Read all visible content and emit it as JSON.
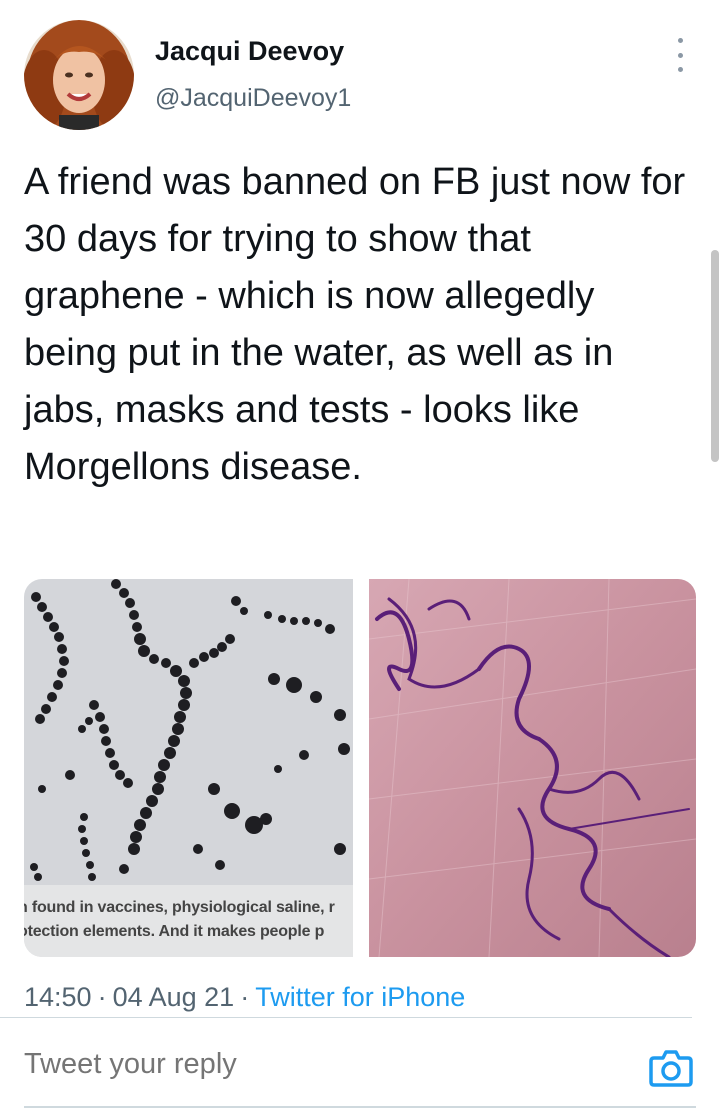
{
  "tweet": {
    "author": {
      "display_name": "Jacqui Deevoy",
      "handle": "@JacquiDeevoy1"
    },
    "text": "A friend was banned on FB just now for 30 days for trying to show that graphene - which is now allegedly being put in the water, as well as in jabs, masks and tests - looks like Morgellons disease.",
    "media": [
      {
        "caption_lines": [
          "n found in vaccines, physiological saline, r",
          "otection elements. And it makes people p"
        ]
      },
      {}
    ],
    "time": "14:50",
    "date": "04 Aug 21",
    "separator": "·",
    "source": "Twitter for iPhone"
  },
  "reply": {
    "placeholder": "Tweet your reply"
  },
  "icons": {
    "more": "more-vertical-icon",
    "camera": "camera-icon"
  },
  "colors": {
    "link": "#1d9bf0",
    "secondary_text": "#536471",
    "primary_text": "#0f1419"
  }
}
